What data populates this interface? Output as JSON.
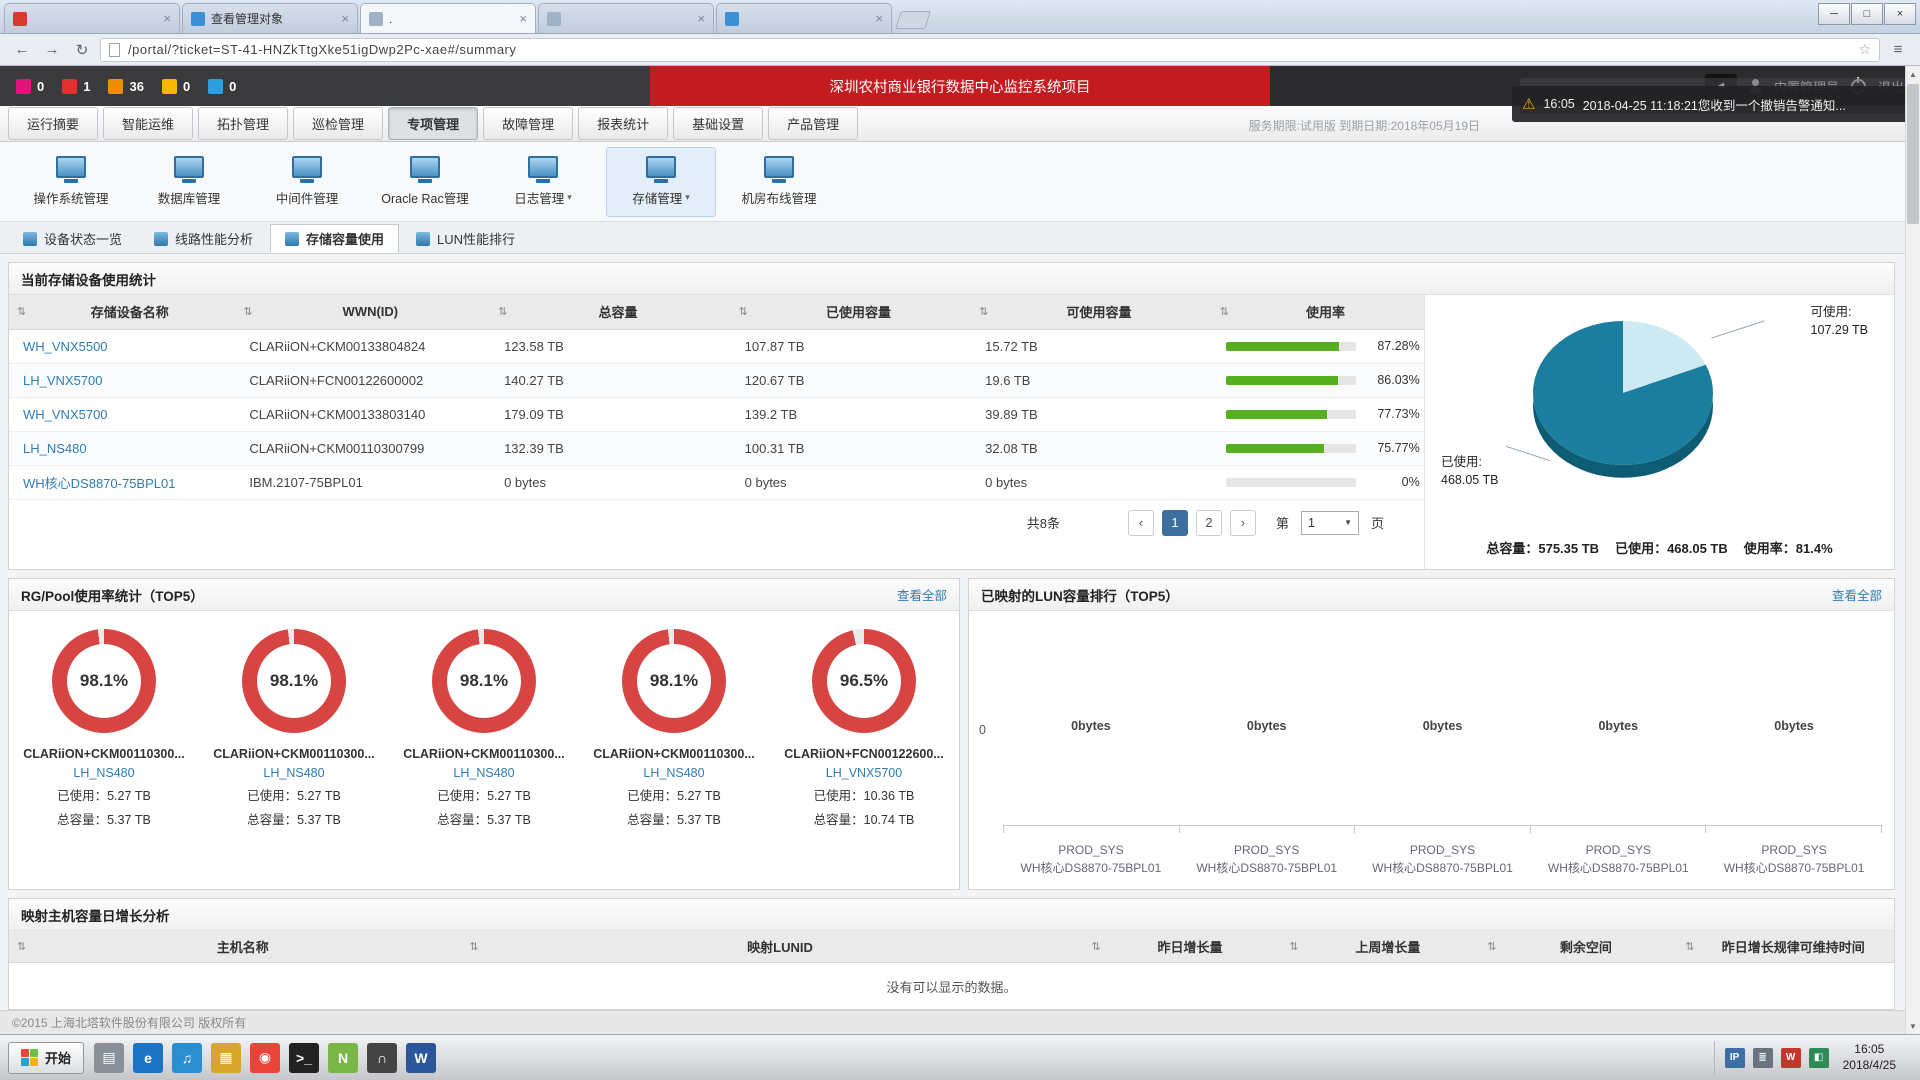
{
  "colors": {
    "donut_red": "#d64541",
    "donut_track": "#e9e9e9",
    "pie_used": "#1b7e9e",
    "pie_free": "#cde9f2",
    "progress_green": "#56af1f"
  },
  "icons": {
    "sort": "⇅",
    "prev": "‹",
    "next": "›",
    "star": "☆",
    "back": "←",
    "forward": "→",
    "refresh": "↻",
    "menu": "≡",
    "caret": "▾",
    "select_caret": "▼",
    "warning": "⚠",
    "close": "×",
    "minimize": "─",
    "maximize": "□",
    "speaker": "◄",
    "up": "▲",
    "down": "▼"
  },
  "browser": {
    "tabs": [
      {
        "title": ""
      },
      {
        "title": "查看管理对象"
      },
      {
        "title": "."
      },
      {
        "title": ""
      },
      {
        "title": ""
      }
    ],
    "url": "/portal/?ticket=ST-41-HNZkTtgXke51igDwp2Pc-xae#/summary"
  },
  "banner": {
    "title": "深圳农村商业银行数据中心监控系统项目",
    "alerts": [
      {
        "count": "0",
        "color": "#e5127d"
      },
      {
        "count": "1",
        "color": "#e03131"
      },
      {
        "count": "36",
        "color": "#f08c00"
      },
      {
        "count": "0",
        "color": "#f5b700"
      },
      {
        "count": "0",
        "color": "#2f9ee0"
      }
    ],
    "user": "内置管理员",
    "logout": "退出"
  },
  "toast": {
    "time": "16:05",
    "text": "2018-04-25 11:18:21您收到一个撤销告警通知..."
  },
  "license": "服务期限:试用版 到期日期:2018年05月19日",
  "nav": {
    "items": [
      "运行摘要",
      "智能运维",
      "拓扑管理",
      "巡检管理",
      "专项管理",
      "故障管理",
      "报表统计",
      "基础设置",
      "产品管理"
    ]
  },
  "icon_menu": {
    "items": [
      {
        "label": "操作系统管理"
      },
      {
        "label": "数据库管理"
      },
      {
        "label": "中间件管理"
      },
      {
        "label": "Oracle Rac管理"
      },
      {
        "label": "日志管理"
      },
      {
        "label": "存储管理"
      },
      {
        "label": "机房布线管理"
      }
    ]
  },
  "sub_tabs": {
    "items": [
      "设备状态一览",
      "线路性能分析",
      "存储容量使用",
      "LUN性能排行"
    ]
  },
  "storage": {
    "title": "当前存储设备使用统计",
    "columns": [
      "存储设备名称",
      "WWN(ID)",
      "总容量",
      "已使用容量",
      "可使用容量",
      "使用率"
    ],
    "rows": [
      {
        "name": "WH_VNX5500",
        "wwn": "CLARiiON+CKM00133804824",
        "total": "123.58 TB",
        "used": "107.87 TB",
        "free": "15.72 TB",
        "pct_label": "87.28%",
        "pct": 87.28
      },
      {
        "name": "LH_VNX5700",
        "wwn": "CLARiiON+FCN00122600002",
        "total": "140.27 TB",
        "used": "120.67 TB",
        "free": "19.6 TB",
        "pct_label": "86.03%",
        "pct": 86.03
      },
      {
        "name": "WH_VNX5700",
        "wwn": "CLARiiON+CKM00133803140",
        "total": "179.09 TB",
        "used": "139.2 TB",
        "free": "39.89 TB",
        "pct_label": "77.73%",
        "pct": 77.73
      },
      {
        "name": "LH_NS480",
        "wwn": "CLARiiON+CKM00110300799",
        "total": "132.39 TB",
        "used": "100.31 TB",
        "free": "32.08 TB",
        "pct_label": "75.77%",
        "pct": 75.77
      },
      {
        "name": "WH核心DS8870-75BPL01",
        "wwn": "IBM.2107-75BPL01",
        "total": "0 bytes",
        "used": "0 bytes",
        "free": "0 bytes",
        "pct_label": "0%",
        "pct": 0
      }
    ],
    "pagination": {
      "total": "共8条",
      "page1": "1",
      "page2": "2",
      "label_di": "第",
      "label_ye": "页",
      "select_value": "1"
    },
    "pie": {
      "used_pct": 81.4,
      "free_label": "可使用:",
      "free_value": "107.29 TB",
      "used_label": "已使用:",
      "used_value": "468.05 TB",
      "sum_total": "总容量：575.35 TB",
      "sum_used": "已使用：468.05 TB",
      "sum_rate": "使用率：81.4%"
    }
  },
  "rg": {
    "title": "RG/Pool使用率统计（TOP5）",
    "view_all": "查看全部",
    "donuts": [
      {
        "pct": 98.1,
        "pct_label": "98.1%",
        "device": "CLARiiON+CKM00110300...",
        "name": "LH_NS480",
        "used": "已使用：5.27 TB",
        "total": "总容量：5.37 TB"
      },
      {
        "pct": 98.1,
        "pct_label": "98.1%",
        "device": "CLARiiON+CKM00110300...",
        "name": "LH_NS480",
        "used": "已使用：5.27 TB",
        "total": "总容量：5.37 TB"
      },
      {
        "pct": 98.1,
        "pct_label": "98.1%",
        "device": "CLARiiON+CKM00110300...",
        "name": "LH_NS480",
        "used": "已使用：5.27 TB",
        "total": "总容量：5.37 TB"
      },
      {
        "pct": 98.1,
        "pct_label": "98.1%",
        "device": "CLARiiON+CKM00110300...",
        "name": "LH_NS480",
        "used": "已使用：5.27 TB",
        "total": "总容量：5.37 TB"
      },
      {
        "pct": 96.5,
        "pct_label": "96.5%",
        "device": "CLARiiON+FCN00122600...",
        "name": "LH_VNX5700",
        "used": "已使用：10.36 TB",
        "total": "总容量：10.74 TB"
      }
    ]
  },
  "lun": {
    "title": "已映射的LUN容量排行（TOP5）",
    "view_all": "查看全部",
    "y_zero": "0",
    "bars": [
      {
        "value": "0bytes",
        "cat1": "PROD_SYS",
        "cat2": "WH核心DS8870-75BPL01"
      },
      {
        "value": "0bytes",
        "cat1": "PROD_SYS",
        "cat2": "WH核心DS8870-75BPL01"
      },
      {
        "value": "0bytes",
        "cat1": "PROD_SYS",
        "cat2": "WH核心DS8870-75BPL01"
      },
      {
        "value": "0bytes",
        "cat1": "PROD_SYS",
        "cat2": "WH核心DS8870-75BPL01"
      },
      {
        "value": "0bytes",
        "cat1": "PROD_SYS",
        "cat2": "WH核心DS8870-75BPL01"
      }
    ]
  },
  "host": {
    "title": "映射主机容量日增长分析",
    "columns": [
      "主机名称",
      "映射LUNID",
      "昨日增长量",
      "上周增长量",
      "剩余空间",
      "昨日增长规律可维持时间"
    ],
    "empty": "没有可以显示的数据。"
  },
  "footer": "©2015 上海北塔软件股份有限公司 版权所有",
  "taskbar": {
    "start": "开始",
    "icons": [
      {
        "glyph": "▤",
        "color": "#8a9098",
        "name": "printer"
      },
      {
        "glyph": "e",
        "color": "#1a73c4",
        "name": "ie"
      },
      {
        "glyph": "♫",
        "color": "#2a8fd0",
        "name": "media-player"
      },
      {
        "glyph": "▦",
        "color": "#d9a52a",
        "name": "folder"
      },
      {
        "glyph": "◉",
        "color": "#e8443a",
        "name": "chrome"
      },
      {
        "glyph": ">_",
        "color": "#222222",
        "name": "terminal"
      },
      {
        "glyph": "N",
        "color": "#7ab648",
        "name": "notepad"
      },
      {
        "glyph": "∩",
        "color": "#444444",
        "name": "headset"
      },
      {
        "glyph": "W",
        "color": "#2b579a",
        "name": "word"
      }
    ],
    "tray": [
      {
        "glyph": "IP",
        "color": "#3a6ea5",
        "name": "input-method"
      },
      {
        "glyph": "≣",
        "color": "#6b7280",
        "name": "keyboard"
      },
      {
        "glyph": "W",
        "color": "#c0392b",
        "name": "tray-app"
      },
      {
        "glyph": "◧",
        "color": "#2e8b57",
        "name": "tray-status"
      }
    ],
    "time": "16:05",
    "date": "2018/4/25"
  }
}
